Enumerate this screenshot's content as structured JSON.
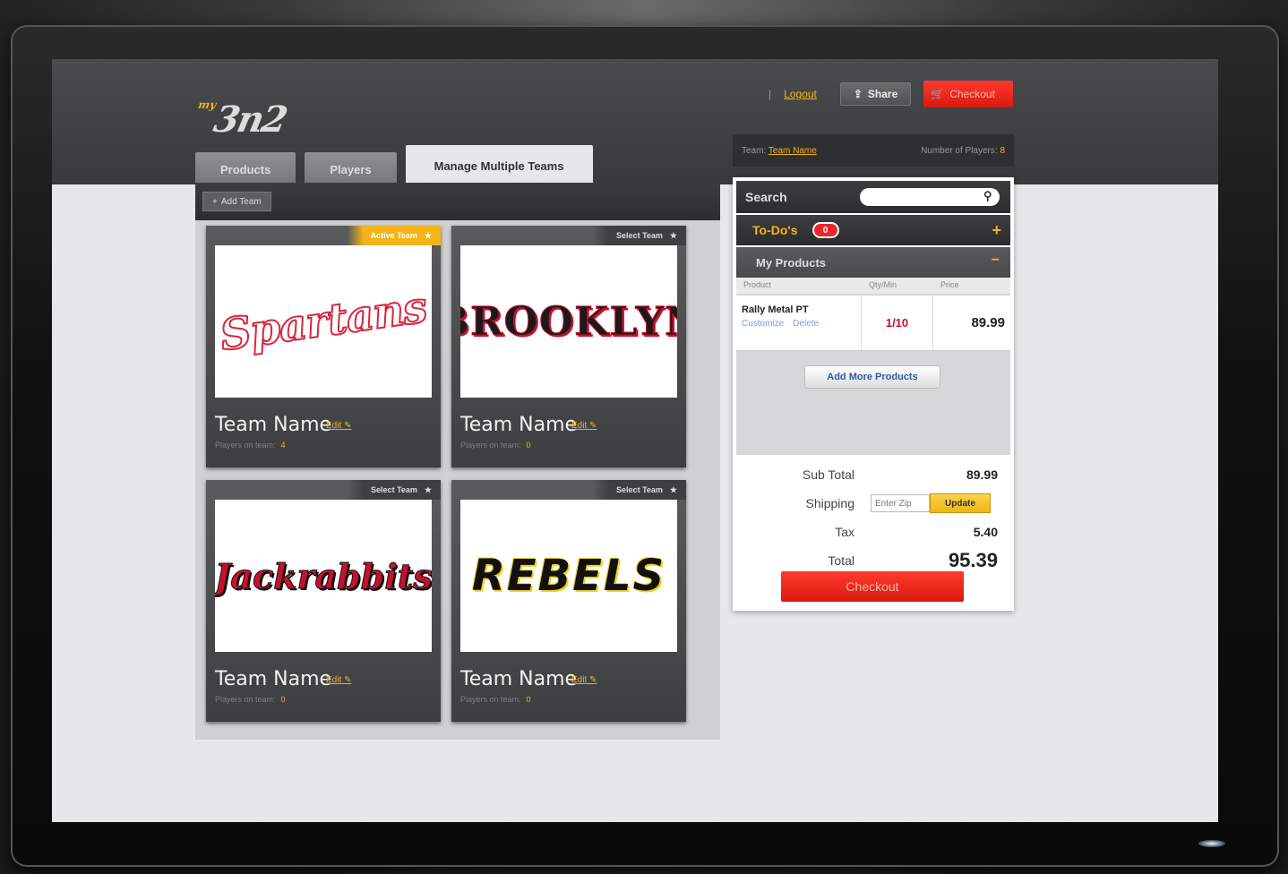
{
  "header": {
    "logo_prefix": "my",
    "logo_text": "3n2",
    "separator": "|",
    "logout_label": "Logout",
    "share_label": "Share",
    "checkout_label": "Checkout"
  },
  "tabs": [
    {
      "label": "Products"
    },
    {
      "label": "Players"
    },
    {
      "label": "Manage Multiple Teams"
    }
  ],
  "team_info": {
    "team_label": "Team:",
    "team_link": "Team Name",
    "players_label": "Number of Players:",
    "players_count": "8"
  },
  "teams_panel": {
    "add_team_label": "Add Team",
    "cards": [
      {
        "select_label": "Active Team",
        "logo_text": "Spartans",
        "name": "Team Name",
        "edit": "Edit",
        "players_label": "Players on team:",
        "players_count": "4"
      },
      {
        "select_label": "Select Team",
        "logo_text": "BROOKLYN",
        "name": "Team Name",
        "edit": "Edit",
        "players_label": "Players on team:",
        "players_count": "0"
      },
      {
        "select_label": "Select Team",
        "logo_text": "Jackrabbits",
        "name": "Team Name",
        "edit": "Edit",
        "players_label": "Players on team:",
        "players_count": "0"
      },
      {
        "select_label": "Select Team",
        "logo_text": "REBELS",
        "name": "Team Name",
        "edit": "Edit",
        "players_label": "Players on team:",
        "players_count": "0"
      }
    ]
  },
  "cart": {
    "search_label": "Search",
    "search_placeholder": "",
    "todo_label": "To-Do's",
    "todo_count": "0",
    "products_label": "My Products",
    "columns": [
      "Product",
      "Qty/Min",
      "Price"
    ],
    "product": {
      "name": "Rally Metal PT",
      "customize": "Customize",
      "delete": "Delete",
      "qty": "1/10",
      "price": "89.99"
    },
    "add_more_label": "Add More Products",
    "subtotal_label": "Sub Total",
    "subtotal": "89.99",
    "shipping_label": "Shipping",
    "zip_placeholder": "Enter Zip",
    "update_label": "Update",
    "tax_label": "Tax",
    "tax": "5.40",
    "total_label": "Total",
    "total": "95.39",
    "checkout_label": "Checkout"
  },
  "colors": {
    "accent_yellow": "#f3b41a",
    "checkout_red": "#e8262c",
    "dark_panel": "#2e2f31"
  }
}
